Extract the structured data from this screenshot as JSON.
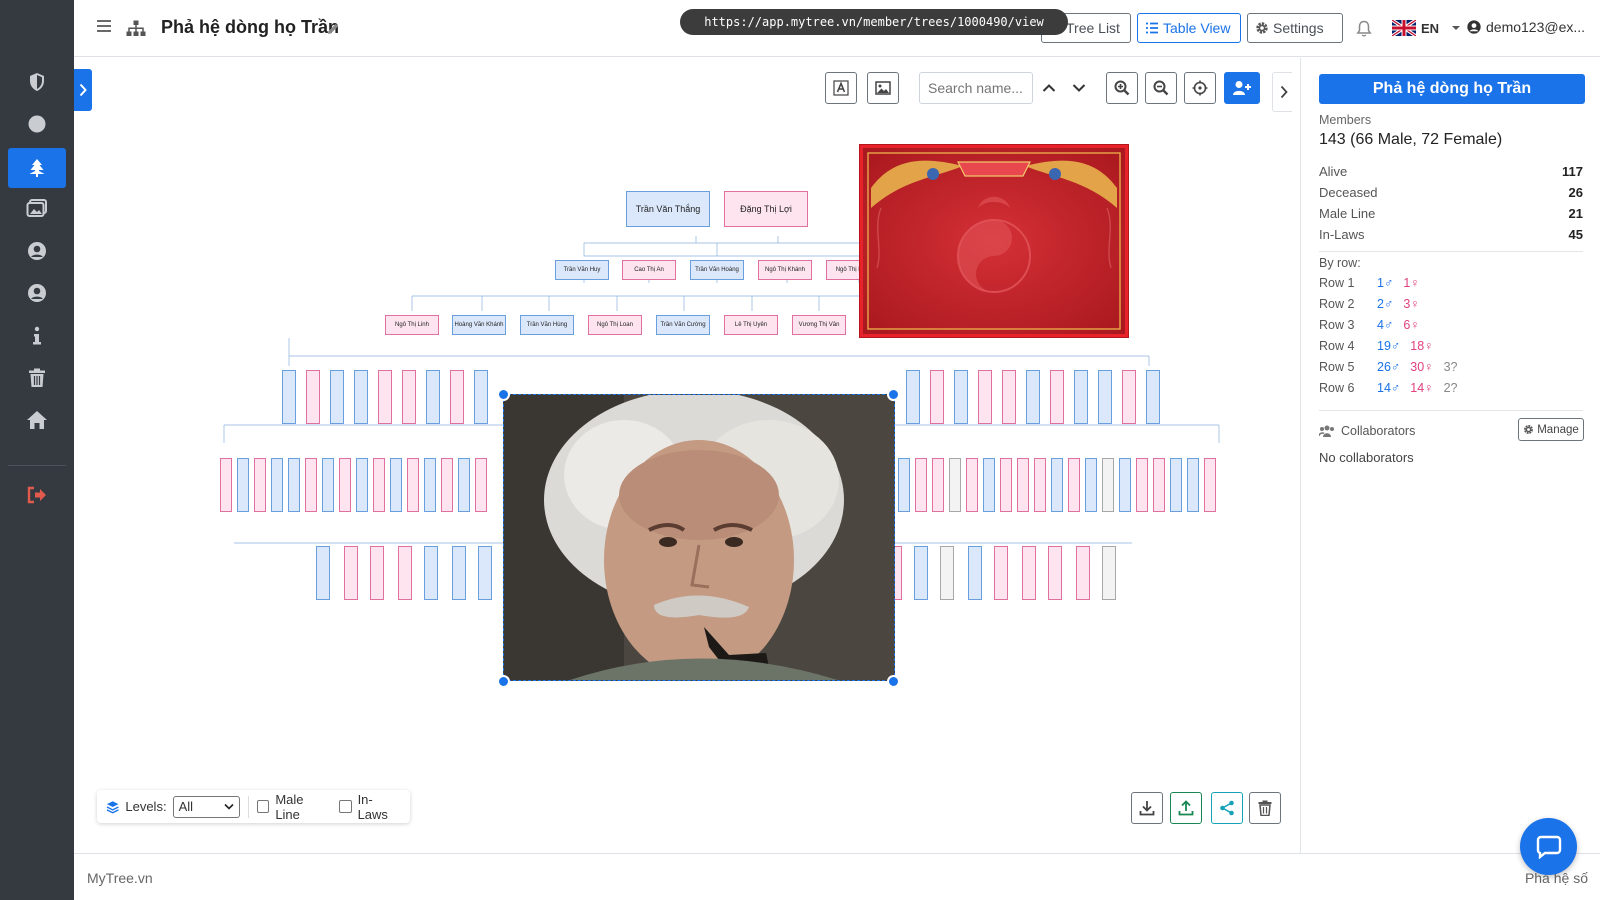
{
  "app": {
    "title": "Phả hệ dòng họ Trần",
    "url": "https://app.mytree.vn/member/trees/1000490/view",
    "accent": "#1a73e8"
  },
  "sidebar": {
    "items": [
      {
        "icon": "shield-icon"
      },
      {
        "icon": "circle-icon"
      },
      {
        "icon": "tree-icon",
        "active": true
      },
      {
        "icon": "gallery-icon"
      },
      {
        "icon": "user-circle-icon"
      },
      {
        "icon": "user-circle-icon"
      },
      {
        "icon": "info-icon"
      },
      {
        "icon": "trash-icon"
      },
      {
        "icon": "home-icon"
      },
      {
        "icon": "logout-icon"
      }
    ]
  },
  "header": {
    "tree_list": "Tree List",
    "table_view": "Table View",
    "settings": "Settings",
    "language": "EN",
    "user": "demo123@ex..."
  },
  "toolbar": {
    "search_placeholder": "Search name..."
  },
  "tree": {
    "top_pair": [
      "Trần Văn Thắng",
      "Đặng Thị Lợi"
    ],
    "row2": [
      {
        "name": "Trần Văn Huy",
        "g": "m"
      },
      {
        "name": "Cao Thị An",
        "g": "f"
      },
      {
        "name": "Trần Văn Hoàng",
        "g": "m"
      },
      {
        "name": "Ngô Thị Khánh",
        "g": "f"
      },
      {
        "name": "Ngô Thị Khải",
        "g": "f"
      }
    ],
    "row3": [
      {
        "name": "Ngô Thị Linh",
        "g": "f"
      },
      {
        "name": "Hoàng Văn Khánh",
        "g": "m"
      },
      {
        "name": "Trần Văn Hùng",
        "g": "m"
      },
      {
        "name": "Ngô Thị Loan",
        "g": "f"
      },
      {
        "name": "Trần Văn Cường",
        "g": "m"
      },
      {
        "name": "Lê Thị Uyên",
        "g": "f"
      },
      {
        "name": "Vương Thị Vân",
        "g": "f"
      }
    ]
  },
  "bottom_bar": {
    "levels_label": "Levels:",
    "levels_value": "All",
    "male_line": "Male Line",
    "in_laws": "In-Laws"
  },
  "panel": {
    "title": "Phả hệ dòng họ Trần",
    "members_label": "Members",
    "members_value": "143 (66 Male, 72 Female)",
    "stats": [
      {
        "label": "Alive",
        "value": "117"
      },
      {
        "label": "Deceased",
        "value": "26"
      },
      {
        "label": "Male Line",
        "value": "21"
      },
      {
        "label": "In-Laws",
        "value": "45"
      }
    ],
    "by_row_label": "By row:",
    "rows": [
      {
        "label": "Row 1",
        "male": "1♂",
        "female": "1♀",
        "unknown": ""
      },
      {
        "label": "Row 2",
        "male": "2♂",
        "female": "3♀",
        "unknown": ""
      },
      {
        "label": "Row 3",
        "male": "4♂",
        "female": "6♀",
        "unknown": ""
      },
      {
        "label": "Row 4",
        "male": "19♂",
        "female": "18♀",
        "unknown": ""
      },
      {
        "label": "Row 5",
        "male": "26♂",
        "female": "30♀",
        "unknown": "3?"
      },
      {
        "label": "Row 6",
        "male": "14♂",
        "female": "14♀",
        "unknown": "2?"
      }
    ],
    "collaborators_label": "Collaborators",
    "manage": "Manage",
    "no_collaborators": "No collaborators"
  },
  "footer": {
    "brand": "MyTree.vn",
    "right": "Phả hệ số"
  }
}
